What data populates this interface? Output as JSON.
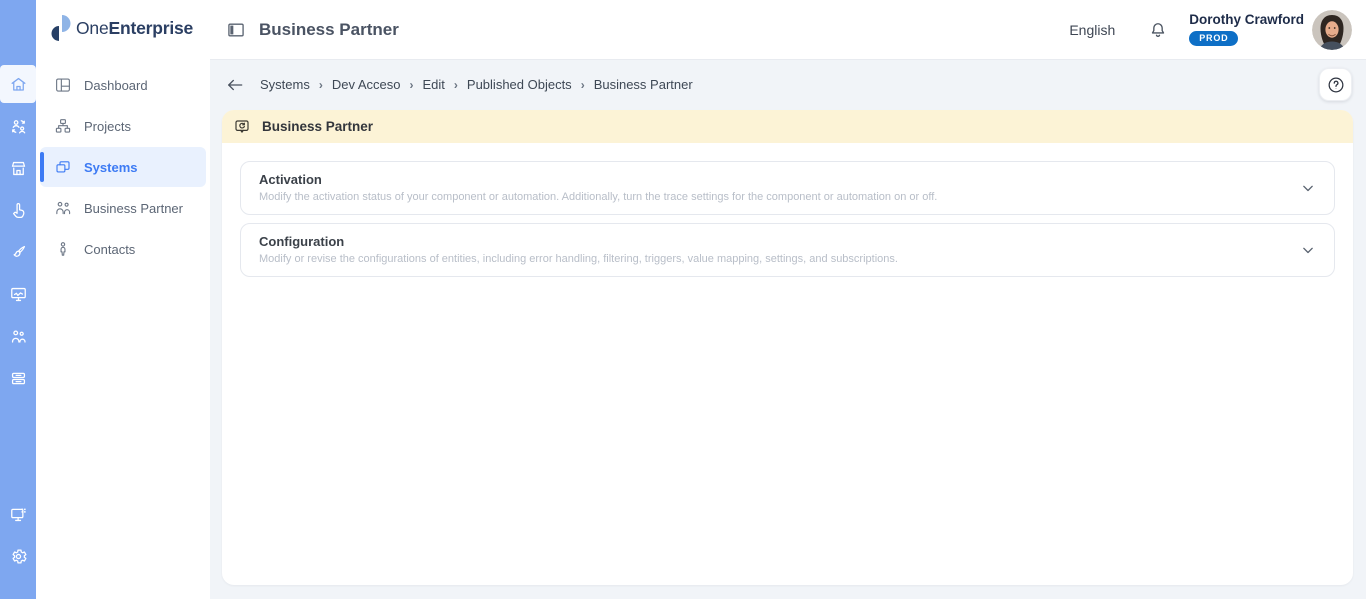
{
  "brand": {
    "name_light": "One",
    "name_bold": "Enterprise"
  },
  "rail": {
    "top_icons": [
      "home",
      "user-sync",
      "storefront",
      "hand-pointer",
      "paintbrush",
      "monitor-activity",
      "users",
      "server-stack"
    ],
    "bottom_icons": [
      "monitor-apps",
      "settings-gear"
    ],
    "active_icon": "home"
  },
  "sidebar": {
    "items": [
      {
        "label": "Dashboard",
        "icon": "dashboard-icon",
        "active": false
      },
      {
        "label": "Projects",
        "icon": "projects-hierarchy-icon",
        "active": false
      },
      {
        "label": "Systems",
        "icon": "systems-windows-icon",
        "active": true
      },
      {
        "label": "Business Partner",
        "icon": "business-partner-people-icon",
        "active": false
      },
      {
        "label": "Contacts",
        "icon": "contact-person-icon",
        "active": false
      }
    ]
  },
  "header": {
    "title": "Business Partner",
    "language": "English",
    "user": {
      "name": "Dorothy Crawford",
      "environment_badge": "PROD"
    }
  },
  "breadcrumb": {
    "separator": "›",
    "items": [
      "Systems",
      "Dev Acceso",
      "Edit",
      "Published Objects",
      "Business Partner"
    ]
  },
  "page_banner": {
    "title": "Business Partner"
  },
  "sections": [
    {
      "title": "Activation",
      "description": "Modify the activation status of your component or automation. Additionally, turn the trace settings for the component or automation on or off."
    },
    {
      "title": "Configuration",
      "description": "Modify or revise the configurations of entities, including error handling, filtering, triggers, value mapping, settings, and subscriptions."
    }
  ],
  "colors": {
    "rail_bg": "#7ea7f0",
    "accent": "#3d7bf4",
    "banner_bg": "#fcf3d6",
    "badge_bg": "#0e6fc6",
    "page_bg": "#f1f4f8",
    "card_border": "#e5e8ee"
  }
}
